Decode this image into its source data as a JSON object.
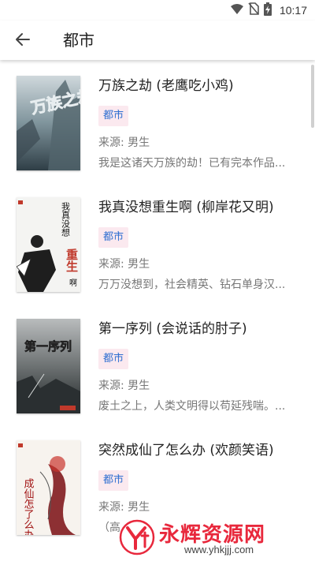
{
  "status_bar": {
    "time": "10:17",
    "icons": [
      "wifi-icon",
      "no-sim-icon",
      "battery-charging-icon"
    ]
  },
  "app_bar": {
    "back_icon": "arrow-back-icon",
    "title": "都市"
  },
  "books": [
    {
      "title": "万族之劫 (老鹰吃小鸡)",
      "tag": "都市",
      "source": "来源: 男生",
      "desc": "我是这诸天万族的劫！已有完本作品...",
      "cover_text": "万族之劫"
    },
    {
      "title": "我真没想重生啊 (柳岸花又明)",
      "tag": "都市",
      "source": "来源: 男生",
      "desc": "万万没想到，社会精英、钻石单身汉...",
      "cover_text_1": "我真没想",
      "cover_text_2": "重生",
      "cover_text_3": "啊"
    },
    {
      "title": "第一序列 (会说话的肘子)",
      "tag": "都市",
      "source": "来源: 男生",
      "desc": "废土之上，人类文明得以苟延残喘。...",
      "cover_text": "第一序列"
    },
    {
      "title": "突然成仙了怎么办 (欢颜笑语)",
      "tag": "都市",
      "source": "来源: 男生",
      "desc": "（高",
      "cover_text": "成仙怎了么办"
    }
  ],
  "watermark": {
    "brand": "永辉资源网",
    "url": "www.yhkjjj.com"
  },
  "colors": {
    "tag_bg": "#fbe9ef",
    "tag_text": "#2f6fd1",
    "brand_red": "#e8283c"
  }
}
